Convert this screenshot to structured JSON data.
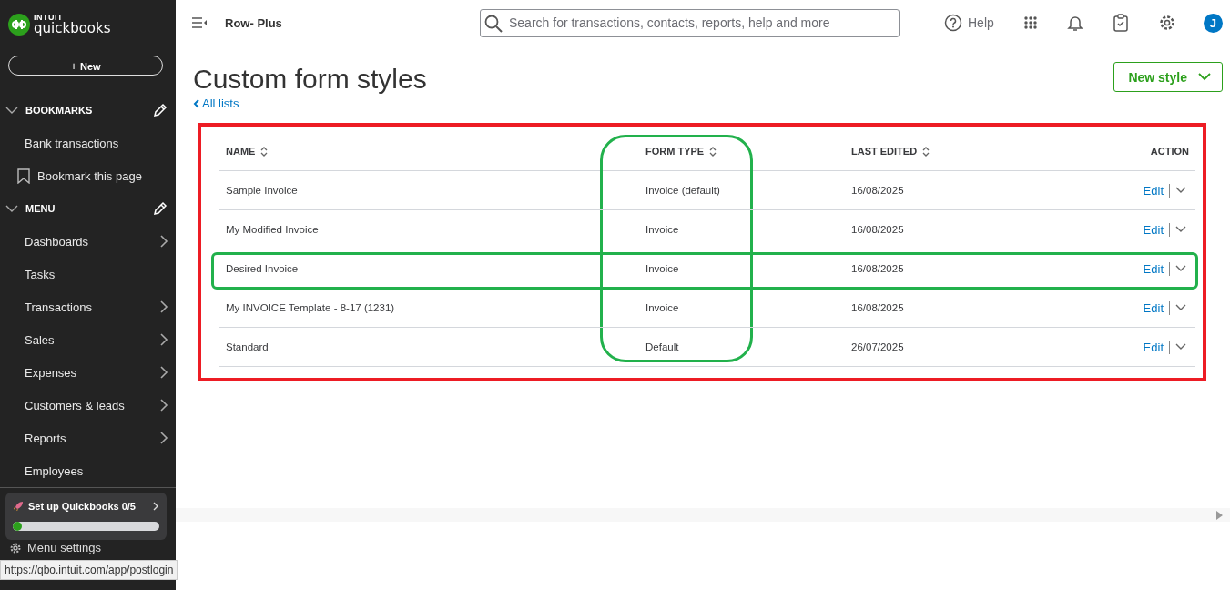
{
  "sidebar": {
    "brand": {
      "top": "INTUIT",
      "name": "quickbooks"
    },
    "new_button": {
      "icon": "+",
      "label": "New"
    },
    "sections": [
      {
        "title": "BOOKMARKS",
        "expanded": true,
        "items": [
          {
            "label": "Bank transactions",
            "kind": "link",
            "has_submenu": false
          },
          {
            "label": "Bookmark this page",
            "kind": "bookmark",
            "has_submenu": false
          }
        ]
      },
      {
        "title": "MENU",
        "expanded": true,
        "items": [
          {
            "label": "Dashboards",
            "kind": "link",
            "has_submenu": true
          },
          {
            "label": "Tasks",
            "kind": "link",
            "has_submenu": false
          },
          {
            "label": "Transactions",
            "kind": "link",
            "has_submenu": true
          },
          {
            "label": "Sales",
            "kind": "link",
            "has_submenu": true
          },
          {
            "label": "Expenses",
            "kind": "link",
            "has_submenu": true
          },
          {
            "label": "Customers & leads",
            "kind": "link",
            "has_submenu": true
          },
          {
            "label": "Reports",
            "kind": "link",
            "has_submenu": true
          },
          {
            "label": "Employees",
            "kind": "link",
            "has_submenu": false
          }
        ]
      }
    ],
    "setup": {
      "label": "Set up Quickbooks 0/5",
      "level": 0.03
    },
    "menu_settings": "Menu settings"
  },
  "status_url": "https://qbo.intuit.com/app/postlogin",
  "topbar": {
    "company": "Row- Plus",
    "search": {
      "placeholder": "Search for transactions, contacts, reports, help and more"
    },
    "help": "Help",
    "avatar": "J"
  },
  "page": {
    "title": "Custom form styles",
    "back_link": "All lists",
    "new_button": "New style"
  },
  "table": {
    "framed": true,
    "columns": [
      {
        "label": "NAME",
        "sortable": true,
        "circled": false
      },
      {
        "label": "FORM TYPE",
        "sortable": true,
        "circled": true
      },
      {
        "label": "LAST EDITED",
        "sortable": true,
        "circled": false
      },
      {
        "label": "ACTION",
        "sortable": false,
        "circled": false
      }
    ],
    "rows": [
      {
        "name": "Sample Invoice",
        "form_type": "Invoice (default)",
        "last_edited": "16/08/2025",
        "action": "Edit",
        "circled": false
      },
      {
        "name": "My Modified Invoice",
        "form_type": "Invoice",
        "last_edited": "16/08/2025",
        "action": "Edit",
        "circled": false
      },
      {
        "name": "Desired Invoice",
        "form_type": "Invoice",
        "last_edited": "16/08/2025",
        "action": "Edit",
        "circled": true
      },
      {
        "name": "My INVOICE Template - 8-17 (1231)",
        "form_type": "Invoice",
        "last_edited": "16/08/2025",
        "action": "Edit",
        "circled": false
      },
      {
        "name": "Standard",
        "form_type": "Default",
        "last_edited": "26/07/2025",
        "action": "Edit",
        "circled": false
      }
    ]
  }
}
